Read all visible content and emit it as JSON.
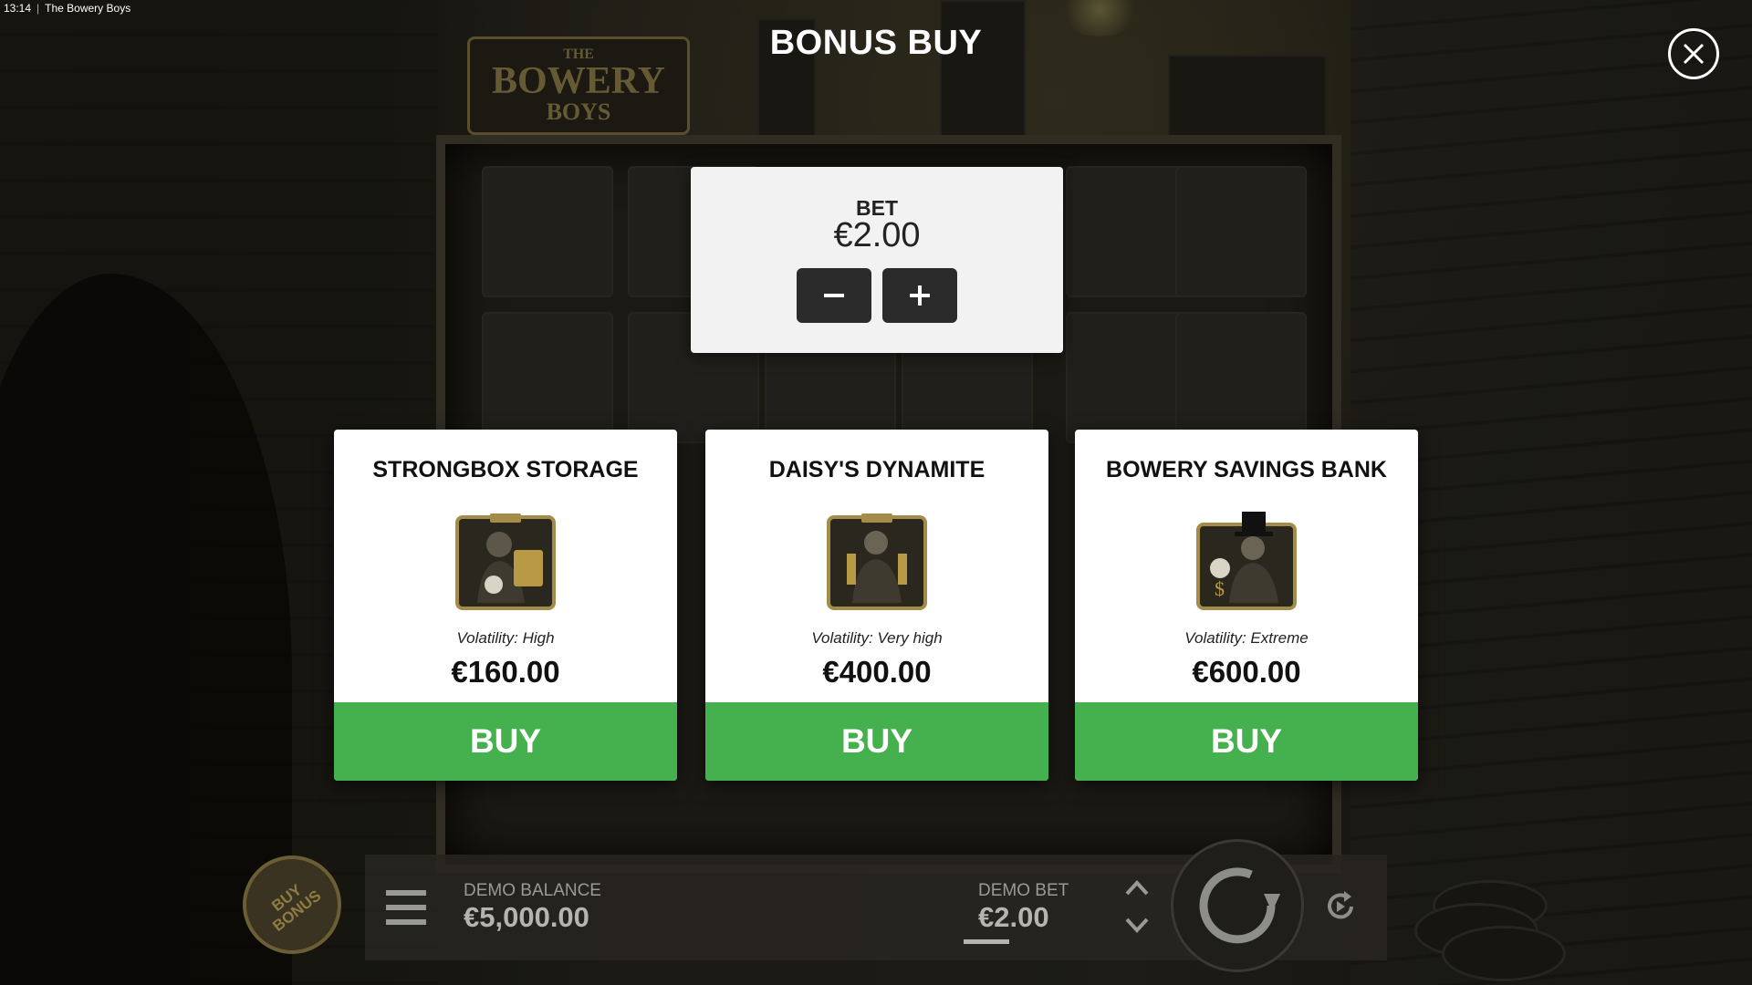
{
  "window": {
    "time": "13:14",
    "title": "The Bowery Boys"
  },
  "game_logo": {
    "line1": "THE",
    "line2": "BOWERY",
    "line3": "BOYS"
  },
  "modal": {
    "title": "BONUS BUY",
    "close_icon": "close-icon"
  },
  "bet_panel": {
    "label": "BET",
    "value": "€2.00",
    "decrease_icon": "minus-icon",
    "increase_icon": "plus-icon"
  },
  "bonuses": [
    {
      "title": "STRONGBOX STORAGE",
      "volatility": "Volatility: High",
      "price": "€160.00",
      "buy_label": "BUY",
      "art_icon": "strongbox-character-icon"
    },
    {
      "title": "DAISY'S DYNAMITE",
      "volatility": "Volatility: Very high",
      "price": "€400.00",
      "buy_label": "BUY",
      "art_icon": "dynamite-character-icon"
    },
    {
      "title": "BOWERY SAVINGS BANK",
      "volatility": "Volatility: Extreme",
      "price": "€600.00",
      "buy_label": "BUY",
      "art_icon": "bank-character-icon"
    }
  ],
  "bottom_bar": {
    "buy_bonus_badge": "BUY BONUS",
    "balance_label": "DEMO BALANCE",
    "balance_value": "€5,000.00",
    "bet_label": "DEMO BET",
    "bet_value": "€2.00"
  },
  "colors": {
    "buy_green": "#45b04e",
    "panel_bg": "#f2f2f2",
    "step_button": "#2b2b2b"
  }
}
